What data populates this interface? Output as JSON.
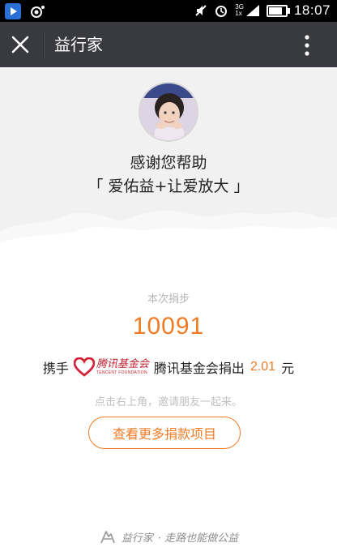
{
  "status_bar": {
    "time": "18:07",
    "network_label": "3G",
    "sim_label": "1x",
    "battery_level": 0.8
  },
  "title_bar": {
    "title": "益行家",
    "close_icon": "close-icon",
    "more_icon": "more-vertical-icon"
  },
  "hero": {
    "thanks": "感谢您帮助",
    "project": "「 爱佑益+让爱放大 」"
  },
  "donation": {
    "steps_label": "本次捐步",
    "steps_value": "10091",
    "prefix": "携手",
    "foundation_logo_cn": "腾讯基金会",
    "foundation_logo_en": "TENCENT FOUNDATION",
    "foundation_name": "腾讯基金会捐出",
    "amount": "2.01",
    "unit": "元"
  },
  "share_hint": "点击右上角，邀请朋友一起来。",
  "more_projects_button": "查看更多捐款项目",
  "footer": {
    "brand": "益行家",
    "slogan": "· 走路也能做公益"
  },
  "colors": {
    "accent": "#f07b24",
    "title_bar": "#393a3f",
    "hero_bg": "#f1f1f1"
  }
}
